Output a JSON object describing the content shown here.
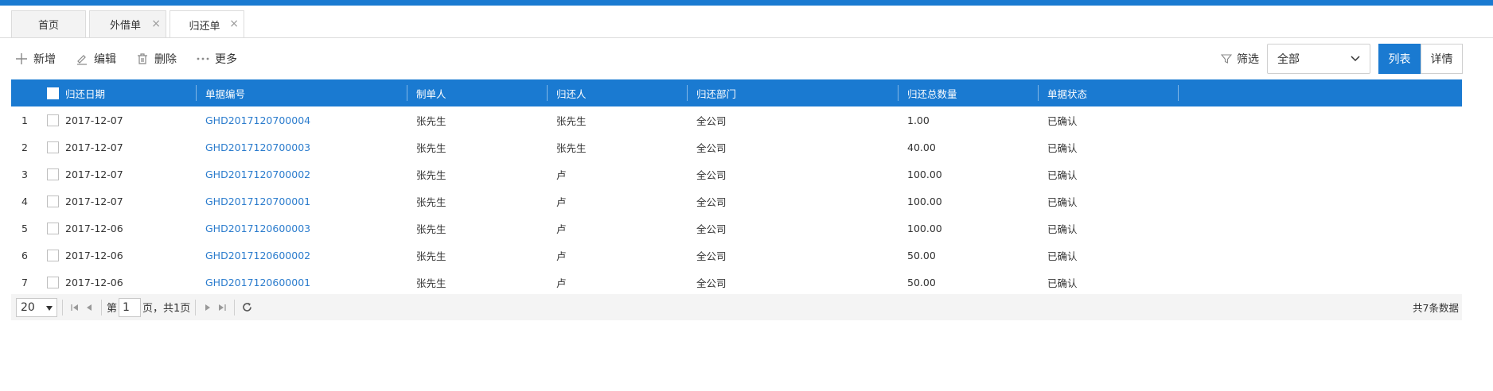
{
  "colors": {
    "accent": "#1a7ad1",
    "link": "#2b7ccd"
  },
  "tabs": [
    {
      "label": "首页",
      "closable": false,
      "active": false
    },
    {
      "label": "外借单",
      "closable": true,
      "active": false
    },
    {
      "label": "归还单",
      "closable": true,
      "active": true
    }
  ],
  "tab_close_glyph": "×",
  "toolbar": {
    "add_label": "新增",
    "edit_label": "编辑",
    "delete_label": "删除",
    "more_label": "更多"
  },
  "filter": {
    "label": "筛选",
    "selected": "全部"
  },
  "view": {
    "list_label": "列表",
    "detail_label": "详情",
    "active": "list"
  },
  "table": {
    "columns": [
      "归还日期",
      "单据编号",
      "制单人",
      "归还人",
      "归还部门",
      "归还总数量",
      "单据状态"
    ],
    "rows": [
      {
        "n": "1",
        "date": "2017-12-07",
        "code": "GHD2017120700004",
        "maker": "张先生",
        "returner": "张先生",
        "dept": "全公司",
        "qty": "1.00",
        "status": "已确认"
      },
      {
        "n": "2",
        "date": "2017-12-07",
        "code": "GHD2017120700003",
        "maker": "张先生",
        "returner": "张先生",
        "dept": "全公司",
        "qty": "40.00",
        "status": "已确认"
      },
      {
        "n": "3",
        "date": "2017-12-07",
        "code": "GHD2017120700002",
        "maker": "张先生",
        "returner": "卢",
        "dept": "全公司",
        "qty": "100.00",
        "status": "已确认"
      },
      {
        "n": "4",
        "date": "2017-12-07",
        "code": "GHD2017120700001",
        "maker": "张先生",
        "returner": "卢",
        "dept": "全公司",
        "qty": "100.00",
        "status": "已确认"
      },
      {
        "n": "5",
        "date": "2017-12-06",
        "code": "GHD2017120600003",
        "maker": "张先生",
        "returner": "卢",
        "dept": "全公司",
        "qty": "100.00",
        "status": "已确认"
      },
      {
        "n": "6",
        "date": "2017-12-06",
        "code": "GHD2017120600002",
        "maker": "张先生",
        "returner": "卢",
        "dept": "全公司",
        "qty": "50.00",
        "status": "已确认"
      },
      {
        "n": "7",
        "date": "2017-12-06",
        "code": "GHD2017120600001",
        "maker": "张先生",
        "returner": "卢",
        "dept": "全公司",
        "qty": "50.00",
        "status": "已确认"
      }
    ]
  },
  "pager": {
    "page_size": "20",
    "page_prefix": "第",
    "current_page": "1",
    "page_suffix": "页，共1页",
    "total_text": "共7条数据"
  },
  "icons": {
    "add": "plus-icon",
    "edit": "pencil-icon",
    "delete": "trash-icon",
    "more": "more-dots-icon",
    "filter": "funnel-icon",
    "dropdown": "chevron-down-icon",
    "refresh": "refresh-icon"
  }
}
